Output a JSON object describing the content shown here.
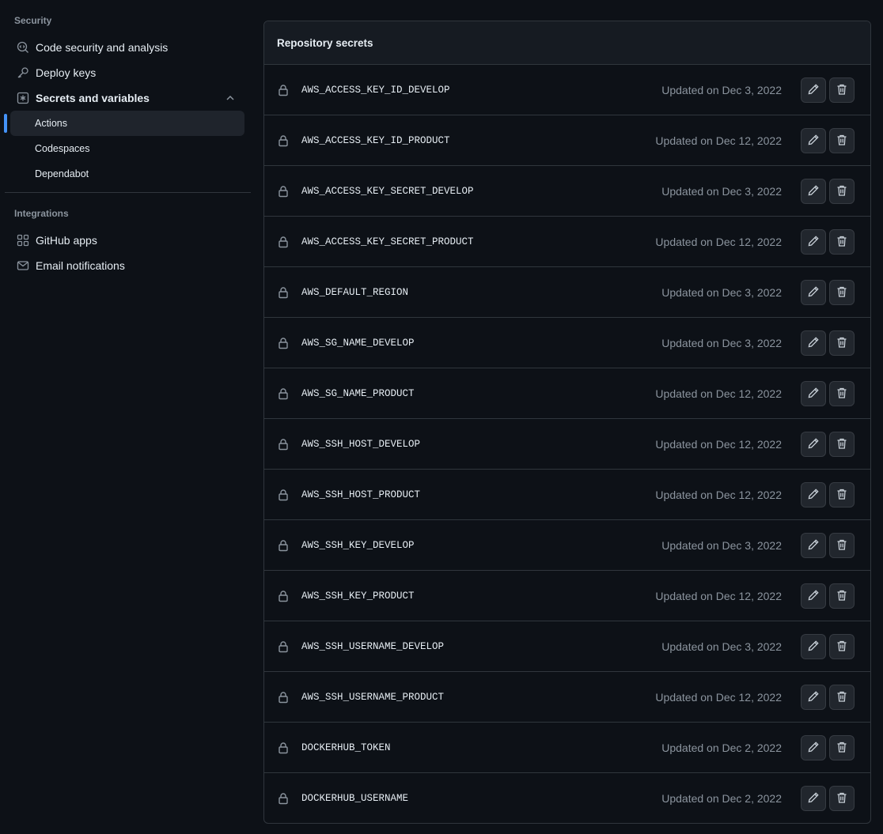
{
  "sidebar": {
    "security_heading": "Security",
    "items": [
      {
        "label": "Code security and analysis",
        "icon": "codescan-icon"
      },
      {
        "label": "Deploy keys",
        "icon": "key-icon"
      },
      {
        "label": "Secrets and variables",
        "icon": "asterisk-square-icon"
      }
    ],
    "sub_items": [
      {
        "label": "Actions",
        "active": true
      },
      {
        "label": "Codespaces",
        "active": false
      },
      {
        "label": "Dependabot",
        "active": false
      }
    ],
    "integrations_heading": "Integrations",
    "integration_items": [
      {
        "label": "GitHub apps",
        "icon": "apps-icon"
      },
      {
        "label": "Email notifications",
        "icon": "mail-icon"
      }
    ]
  },
  "panel": {
    "title": "Repository secrets",
    "secrets": [
      {
        "name": "AWS_ACCESS_KEY_ID_DEVELOP",
        "updated": "Updated on Dec 3, 2022"
      },
      {
        "name": "AWS_ACCESS_KEY_ID_PRODUCT",
        "updated": "Updated on Dec 12, 2022"
      },
      {
        "name": "AWS_ACCESS_KEY_SECRET_DEVELOP",
        "updated": "Updated on Dec 3, 2022"
      },
      {
        "name": "AWS_ACCESS_KEY_SECRET_PRODUCT",
        "updated": "Updated on Dec 12, 2022"
      },
      {
        "name": "AWS_DEFAULT_REGION",
        "updated": "Updated on Dec 3, 2022"
      },
      {
        "name": "AWS_SG_NAME_DEVELOP",
        "updated": "Updated on Dec 3, 2022"
      },
      {
        "name": "AWS_SG_NAME_PRODUCT",
        "updated": "Updated on Dec 12, 2022"
      },
      {
        "name": "AWS_SSH_HOST_DEVELOP",
        "updated": "Updated on Dec 12, 2022"
      },
      {
        "name": "AWS_SSH_HOST_PRODUCT",
        "updated": "Updated on Dec 12, 2022"
      },
      {
        "name": "AWS_SSH_KEY_DEVELOP",
        "updated": "Updated on Dec 3, 2022"
      },
      {
        "name": "AWS_SSH_KEY_PRODUCT",
        "updated": "Updated on Dec 12, 2022"
      },
      {
        "name": "AWS_SSH_USERNAME_DEVELOP",
        "updated": "Updated on Dec 3, 2022"
      },
      {
        "name": "AWS_SSH_USERNAME_PRODUCT",
        "updated": "Updated on Dec 12, 2022"
      },
      {
        "name": "DOCKERHUB_TOKEN",
        "updated": "Updated on Dec 2, 2022"
      },
      {
        "name": "DOCKERHUB_USERNAME",
        "updated": "Updated on Dec 2, 2022"
      }
    ]
  },
  "colors": {
    "background": "#0d1117",
    "panel_header": "#161b22",
    "border": "#30363d",
    "accent": "#4493f8",
    "muted_text": "#8b949e"
  }
}
